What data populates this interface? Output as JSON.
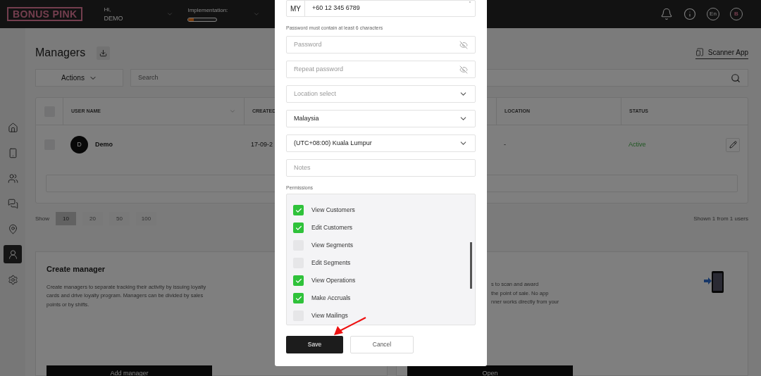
{
  "header": {
    "logo": "BONUS PINK",
    "greeting": "Hi,",
    "user": "DEMO",
    "implementation": {
      "label": "Implementation:",
      "level": 0.2
    },
    "language": "En",
    "account_initial": "B"
  },
  "page": {
    "title": "Managers",
    "scanner_link": "Scanner App",
    "actions": "Actions",
    "search": {
      "placeholder": "Search"
    }
  },
  "sidebar": {
    "items": [
      {
        "kind": "home",
        "selected": false
      },
      {
        "kind": "phone",
        "selected": false
      },
      {
        "kind": "users",
        "selected": false
      },
      {
        "kind": "chat",
        "selected": false
      },
      {
        "kind": "pin",
        "selected": false
      },
      {
        "kind": "user",
        "selected": true
      },
      {
        "kind": "settings",
        "selected": false
      }
    ]
  },
  "table": {
    "select_all": {
      "checked": false
    },
    "columns": [
      "USER NAME",
      "CREATED",
      "LOCATION",
      "STATUS"
    ],
    "rows": [
      {
        "checked": false,
        "initial": "D",
        "name": "Demo",
        "created": "17-09-2",
        "location": "-",
        "status": "Active"
      }
    ]
  },
  "pagination": {
    "label": "Show",
    "sizes": [
      {
        "label": "10",
        "selected": true
      },
      {
        "label": "20",
        "selected": false
      },
      {
        "label": "50",
        "selected": false
      },
      {
        "label": "100",
        "selected": false
      }
    ],
    "summary": "Shown 1 from 1 users"
  },
  "cards": [
    {
      "title": "Create manager",
      "text": "Create managers to separate tracking their activity by issuing loyalty cards and drive loyalty program. Managers can be divided by sales points or by shifts.",
      "button": "Add manager"
    },
    {
      "text_lines": [
        "s to scan and award",
        "the point of sale. No app",
        "nner works directly from your"
      ],
      "button": "Open"
    }
  ],
  "modal": {
    "phone": {
      "country": "MY",
      "value": "+60 12 345 6789",
      "required_mark": "*"
    },
    "password_hint": "Password must contain at least 6 characters",
    "fields": [
      {
        "kind": "password",
        "placeholder": "Password"
      },
      {
        "kind": "password",
        "placeholder": "Repeat password"
      },
      {
        "kind": "select",
        "placeholder": "Location select"
      },
      {
        "kind": "select",
        "value": "Malaysia"
      },
      {
        "kind": "select",
        "value": "(UTC+08:00) Kuala Lumpur"
      },
      {
        "kind": "text",
        "placeholder": "Notes"
      }
    ],
    "permissions_label": "Permissions",
    "permissions": [
      {
        "label": "View Customers",
        "checked": true
      },
      {
        "label": "Edit Customers",
        "checked": true
      },
      {
        "label": "View Segments",
        "checked": false
      },
      {
        "label": "Edit Segments",
        "checked": false
      },
      {
        "label": "View Operations",
        "checked": true
      },
      {
        "label": "Make Accruals",
        "checked": true
      },
      {
        "label": "View Mailings",
        "checked": false
      }
    ],
    "save": "Save",
    "cancel": "Cancel"
  }
}
